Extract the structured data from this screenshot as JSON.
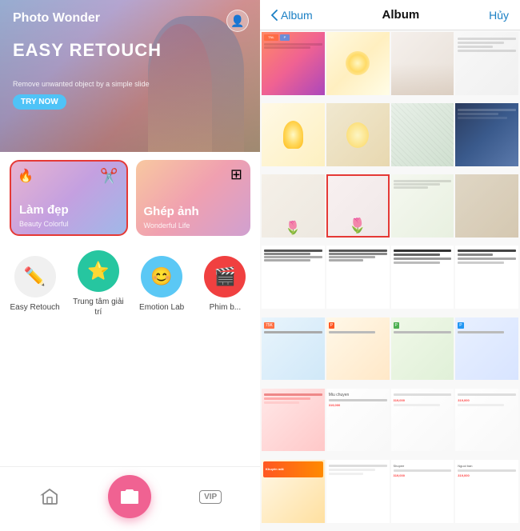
{
  "app": {
    "name": "Photo Wonder",
    "hero": {
      "title": "EASY RETOUCH",
      "subtitle": "Remove unwanted object by a simple slide",
      "btn": "TRY NOW"
    },
    "cards": [
      {
        "label": "Làm đẹp",
        "sub": "Beauty Colorful",
        "icon": "✂",
        "selected": true
      },
      {
        "label": "Ghép ảnh",
        "sub": "Wonderful Life",
        "icon": "⊞"
      }
    ],
    "tools": [
      {
        "label": "Easy Retouch",
        "icon": "✏️",
        "color": "gray"
      },
      {
        "label": "Trung tâm giải trí",
        "icon": "⭐",
        "color": "teal"
      },
      {
        "label": "Emotion Lab",
        "icon": "😊",
        "color": "yellow"
      },
      {
        "label": "Phim b...",
        "icon": "🎬",
        "color": "red"
      }
    ],
    "nav": {
      "home_icon": "🏠",
      "camera_icon": "📷",
      "vip_icon": "VIP"
    }
  },
  "album": {
    "back_label": "Album",
    "cancel_label": "Hủy",
    "photos": [
      {
        "id": 1,
        "class": "p1",
        "type": "colorful"
      },
      {
        "id": 2,
        "class": "p2",
        "type": "light"
      },
      {
        "id": 3,
        "class": "p3",
        "type": "gray"
      },
      {
        "id": 4,
        "class": "p4",
        "type": "white"
      },
      {
        "id": 5,
        "class": "p5",
        "type": "lamp"
      },
      {
        "id": 6,
        "class": "p6",
        "type": "lamp2"
      },
      {
        "id": 7,
        "class": "p7",
        "type": "light"
      },
      {
        "id": 8,
        "class": "p8",
        "type": "social"
      },
      {
        "id": 9,
        "class": "p9",
        "type": "flower"
      },
      {
        "id": 10,
        "class": "p10",
        "type": "flower2",
        "selected": true
      },
      {
        "id": 11,
        "class": "p11",
        "type": "product"
      },
      {
        "id": 12,
        "class": "p12",
        "type": "book"
      },
      {
        "id": 13,
        "class": "p13",
        "type": "text"
      },
      {
        "id": 14,
        "class": "p14",
        "type": "text2"
      },
      {
        "id": 15,
        "class": "p15",
        "type": "text3"
      },
      {
        "id": 16,
        "class": "p16",
        "type": "ad"
      },
      {
        "id": 17,
        "class": "p17",
        "type": "ad2"
      },
      {
        "id": 18,
        "class": "p18",
        "type": "ad3"
      },
      {
        "id": 19,
        "class": "p19",
        "type": "ad4"
      },
      {
        "id": 20,
        "class": "p20",
        "type": "ad5"
      },
      {
        "id": 21,
        "class": "p21",
        "type": "ad6"
      },
      {
        "id": 22,
        "class": "p22",
        "type": "ad7"
      },
      {
        "id": 23,
        "class": "p23",
        "type": "ad8"
      },
      {
        "id": 24,
        "class": "p24",
        "type": "text4"
      },
      {
        "id": 25,
        "class": "p25",
        "type": "text5"
      },
      {
        "id": 26,
        "class": "p26",
        "type": "text6"
      },
      {
        "id": 27,
        "class": "p27",
        "type": "text7"
      },
      {
        "id": 28,
        "class": "p28",
        "type": "ad9"
      },
      {
        "id": 29,
        "class": "p29",
        "type": "ad10"
      },
      {
        "id": 30,
        "class": "p30",
        "type": "ad11"
      },
      {
        "id": 31,
        "class": "p31",
        "type": "ad12"
      },
      {
        "id": 32,
        "class": "p32",
        "type": "ad13"
      }
    ]
  }
}
